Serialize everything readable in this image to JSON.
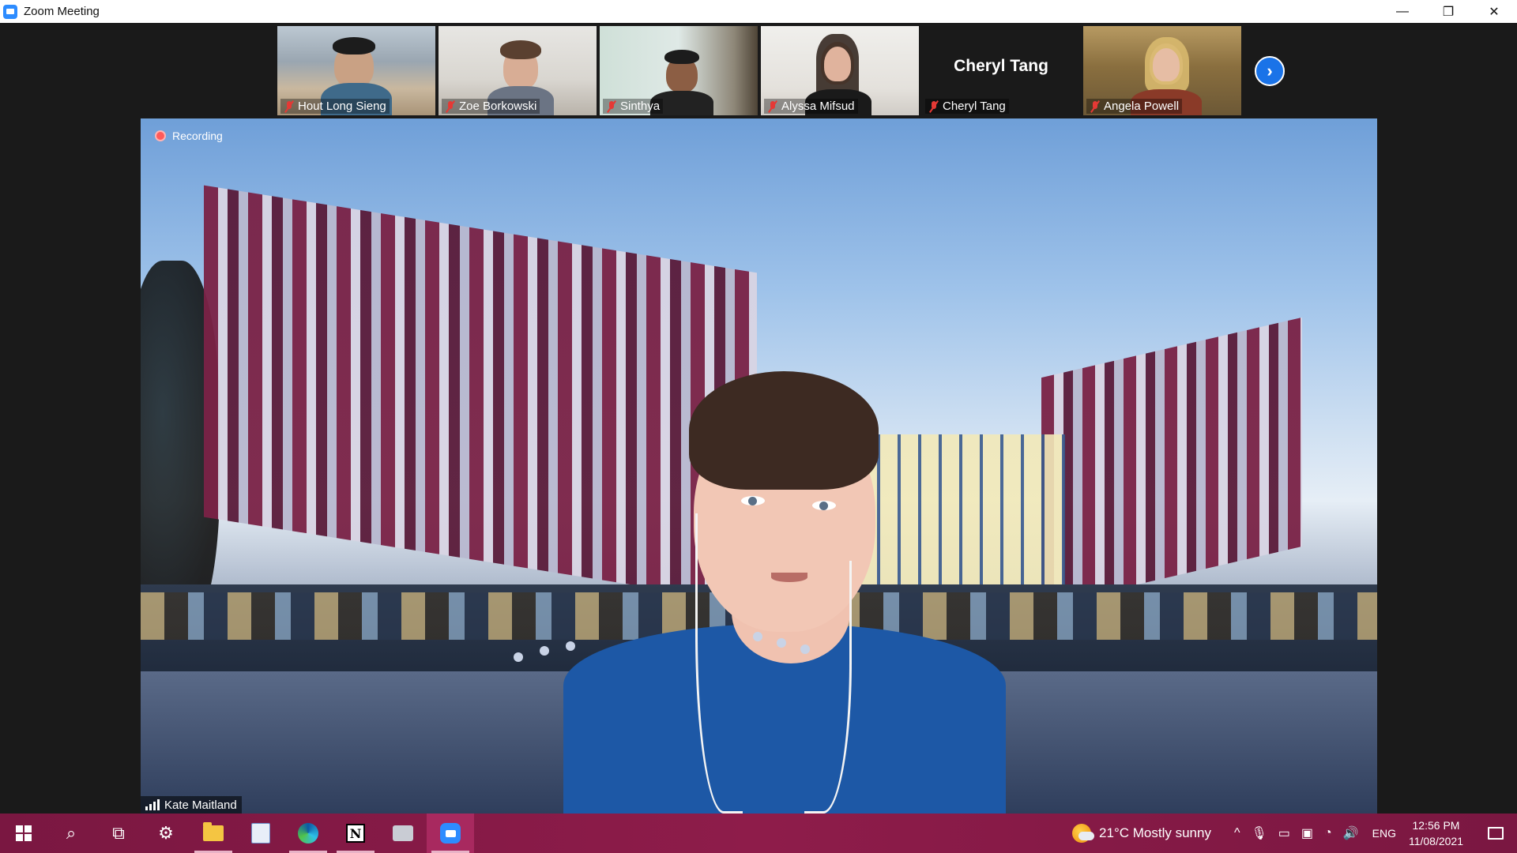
{
  "window": {
    "title": "Zoom Meeting",
    "minimize": "—",
    "restore": "❐",
    "close": "✕"
  },
  "participants": [
    {
      "name": "Hout Long Sieng",
      "muted": true,
      "video": true
    },
    {
      "name": "Zoe Borkowski",
      "muted": true,
      "video": true
    },
    {
      "name": "Sinthya",
      "muted": true,
      "video": true
    },
    {
      "name": "Alyssa Mifsud",
      "muted": true,
      "video": true
    },
    {
      "name": "Cheryl Tang",
      "display_name": "Cheryl Tang",
      "muted": true,
      "video": false
    },
    {
      "name": "Angela Powell",
      "muted": true,
      "video": true
    }
  ],
  "strip": {
    "next_icon": "›"
  },
  "main": {
    "recording_label": "Recording",
    "speaker_name": "Kate Maitland"
  },
  "taskbar": {
    "weather": "21°C  Mostly sunny",
    "tray_chevron": "^",
    "mic": "🎙",
    "battery": "▭",
    "display": "▣",
    "wifi": "◔",
    "volume": "🔊",
    "language": "ENG",
    "time": "12:56 PM",
    "date": "11/08/2021",
    "search_glyph": "⌕",
    "taskview_glyph": "⧉",
    "settings_glyph": "⚙",
    "notion_letter": "N"
  },
  "colors": {
    "accent": "#2d8cff",
    "taskbar": "#8e1c4a",
    "muted": "#e53935",
    "recording": "#ff5a5a"
  }
}
